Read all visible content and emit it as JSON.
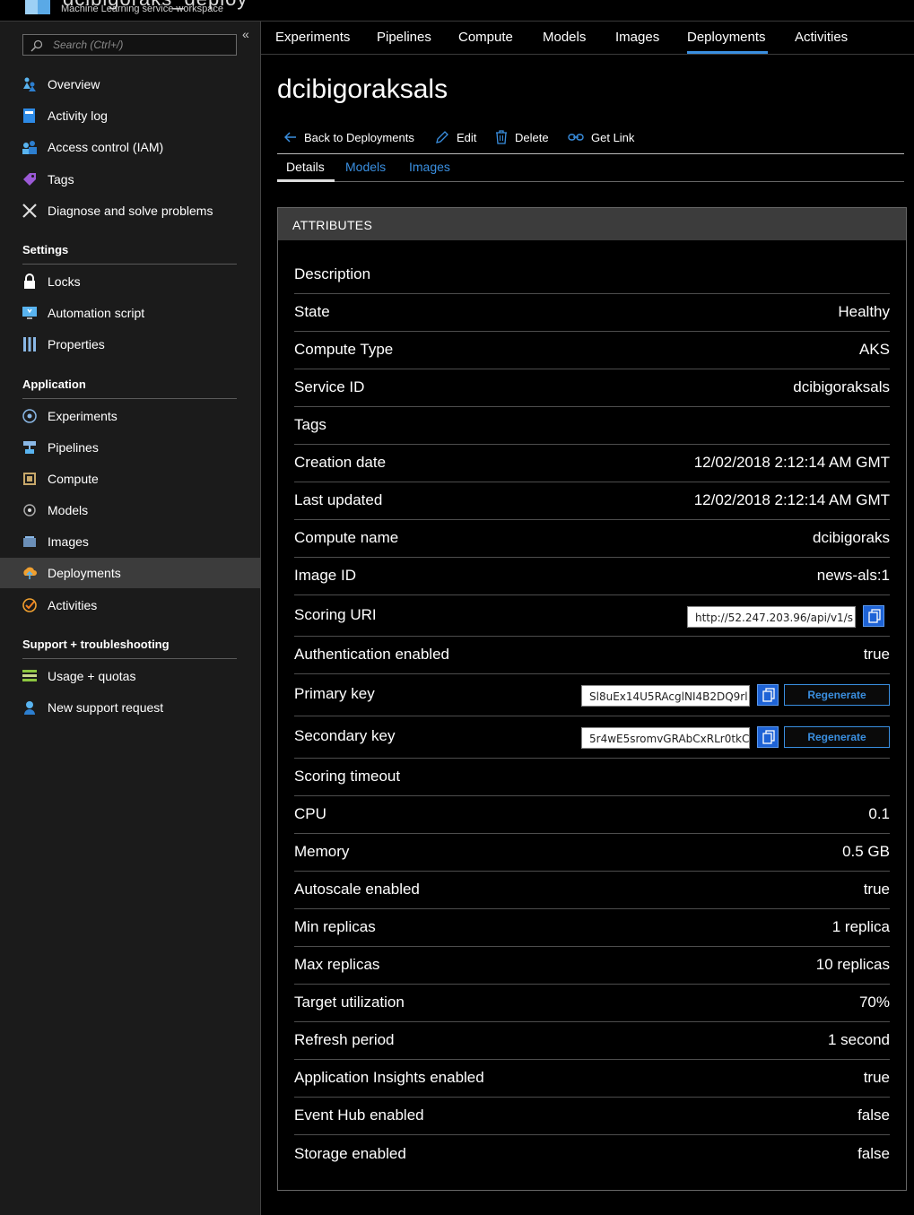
{
  "workspace": {
    "title": "dcibigoraks_deploy",
    "subtitle": "Machine Learning service workspace"
  },
  "search": {
    "placeholder": "Search (Ctrl+/)"
  },
  "sidebar": {
    "collapse_glyph": "«",
    "top_items": [
      {
        "label": "Overview",
        "icon": "overview-icon"
      },
      {
        "label": "Activity log",
        "icon": "activity-log-icon"
      },
      {
        "label": "Access control (IAM)",
        "icon": "iam-icon"
      },
      {
        "label": "Tags",
        "icon": "tag-icon"
      },
      {
        "label": "Diagnose and solve problems",
        "icon": "wrench-icon"
      }
    ],
    "settings_header": "Settings",
    "settings_items": [
      {
        "label": "Locks",
        "icon": "lock-icon"
      },
      {
        "label": "Automation script",
        "icon": "automation-script-icon"
      },
      {
        "label": "Properties",
        "icon": "properties-icon"
      }
    ],
    "application_header": "Application",
    "application_items": [
      {
        "label": "Experiments",
        "icon": "experiments-icon"
      },
      {
        "label": "Pipelines",
        "icon": "pipelines-icon"
      },
      {
        "label": "Compute",
        "icon": "compute-icon"
      },
      {
        "label": "Models",
        "icon": "models-icon"
      },
      {
        "label": "Images",
        "icon": "images-icon"
      },
      {
        "label": "Deployments",
        "icon": "deployments-icon",
        "active": true
      },
      {
        "label": "Activities",
        "icon": "activities-icon"
      }
    ],
    "support_header": "Support + troubleshooting",
    "support_items": [
      {
        "label": "Usage + quotas",
        "icon": "usage-quotas-icon"
      },
      {
        "label": "New support request",
        "icon": "support-request-icon"
      }
    ]
  },
  "tabs": [
    {
      "label": "Experiments"
    },
    {
      "label": "Pipelines"
    },
    {
      "label": "Compute"
    },
    {
      "label": "Models"
    },
    {
      "label": "Images"
    },
    {
      "label": "Deployments",
      "active": true
    },
    {
      "label": "Activities"
    }
  ],
  "page": {
    "title": "dcibigoraksals",
    "commands": {
      "back": "Back to Deployments",
      "edit": "Edit",
      "delete": "Delete",
      "get_link": "Get Link"
    },
    "subtabs": {
      "details": "Details",
      "models": "Models",
      "images": "Images",
      "active": "details"
    }
  },
  "attributes": {
    "header": "ATTRIBUTES",
    "rows": [
      {
        "key": "Description",
        "value": ""
      },
      {
        "key": "State",
        "value": "Healthy"
      },
      {
        "key": "Compute Type",
        "value": "AKS"
      },
      {
        "key": "Service ID",
        "value": "dcibigoraksals"
      },
      {
        "key": "Tags",
        "value": ""
      },
      {
        "key": "Creation date",
        "value": "12/02/2018 2:12:14 AM GMT"
      },
      {
        "key": "Last updated",
        "value": "12/02/2018 2:12:14 AM GMT"
      },
      {
        "key": "Compute name",
        "value": "dcibigoraks"
      },
      {
        "key": "Image ID",
        "value": "news-als:1"
      },
      {
        "key": "Scoring URI",
        "value": "http://52.247.203.96/api/v1/s"
      },
      {
        "key": "Authentication enabled",
        "value": "true"
      },
      {
        "key": "Primary key",
        "value": "Sl8uEx14U5RAcglNI4B2DQ9rl"
      },
      {
        "key": "Secondary key",
        "value": "5r4wE5sromvGRAbCxRLr0tkC"
      },
      {
        "key": "Scoring timeout",
        "value": ""
      },
      {
        "key": "CPU",
        "value": "0.1"
      },
      {
        "key": "Memory",
        "value": "0.5 GB"
      },
      {
        "key": "Autoscale enabled",
        "value": "true"
      },
      {
        "key": "Min replicas",
        "value": "1 replica"
      },
      {
        "key": "Max replicas",
        "value": "10 replicas"
      },
      {
        "key": "Target utilization",
        "value": "70%"
      },
      {
        "key": "Refresh period",
        "value": "1 second"
      },
      {
        "key": "Application Insights enabled",
        "value": "true"
      },
      {
        "key": "Event Hub enabled",
        "value": "false"
      },
      {
        "key": "Storage enabled",
        "value": "false"
      }
    ],
    "regenerate_label": "Regenerate"
  },
  "colors": {
    "accent": "#3a8fe0",
    "sidebar_bg": "#1b1b1b",
    "active_item_bg": "#3c3c3c",
    "card_header_bg": "#3c3c3c",
    "copy_button": "#1e63d6"
  }
}
